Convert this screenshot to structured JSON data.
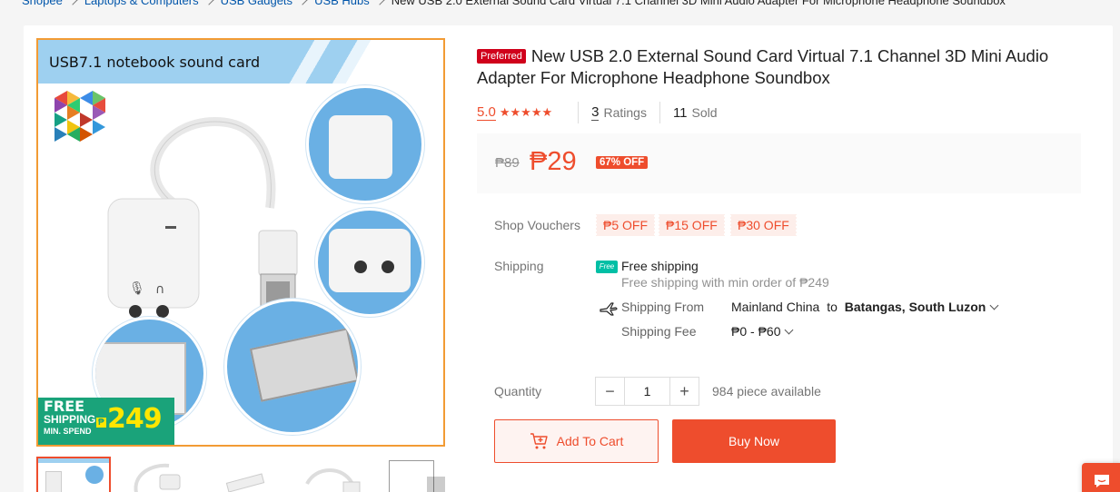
{
  "breadcrumb": {
    "items": [
      "Shopee",
      "Laptops & Computers",
      "USB Gadgets",
      "USB Hubs"
    ],
    "current": "New USB 2.0 External Sound Card Virtual 7.1 Channel 3D Mini Audio Adapter For Microphone Headphone Soundbox"
  },
  "gallery": {
    "banner_text": "USB7.1 notebook sound card",
    "badge": {
      "line1": "FREE",
      "line2": "SHIPPING",
      "line3": "MIN. SPEND",
      "currency": "₱",
      "amount": "249"
    }
  },
  "product": {
    "preferred_label": "Preferred",
    "title": "New USB 2.0 External Sound Card Virtual 7.1 Channel 3D Mini Audio Adapter For Microphone Headphone Soundbox",
    "rating": "5.0",
    "stars": "★★★★★",
    "ratings_count": "3",
    "ratings_label": "Ratings",
    "sold_count": "11",
    "sold_label": "Sold"
  },
  "price": {
    "original": "₱89",
    "current": "₱29",
    "discount": "67% OFF"
  },
  "vouchers": {
    "label": "Shop Vouchers",
    "items": [
      "₱5 OFF",
      "₱15 OFF",
      "₱30 OFF"
    ]
  },
  "shipping": {
    "label": "Shipping",
    "free_icon_text": "Free",
    "free_title": "Free shipping",
    "free_note": "Free shipping with min order of ₱249",
    "from_label": "Shipping From",
    "from_value": "Mainland China",
    "to_word": "to",
    "destination": "Batangas, South Luzon",
    "fee_label": "Shipping Fee",
    "fee_value": "₱0 - ₱60"
  },
  "quantity": {
    "label": "Quantity",
    "minus": "−",
    "value": "1",
    "plus": "+",
    "available": "984 piece available"
  },
  "actions": {
    "add_to_cart": "Add To Cart",
    "buy_now": "Buy Now"
  },
  "colors": {
    "accent": "#ee4d2d",
    "preferred": "#d0011b",
    "frame": "#f29b34",
    "badge_green": "#1aa37a",
    "badge_yellow": "#ffe600"
  },
  "icons": [
    "truck-free-icon",
    "plane-icon",
    "cart-icon",
    "chat-icon",
    "chevron-down-icon"
  ]
}
